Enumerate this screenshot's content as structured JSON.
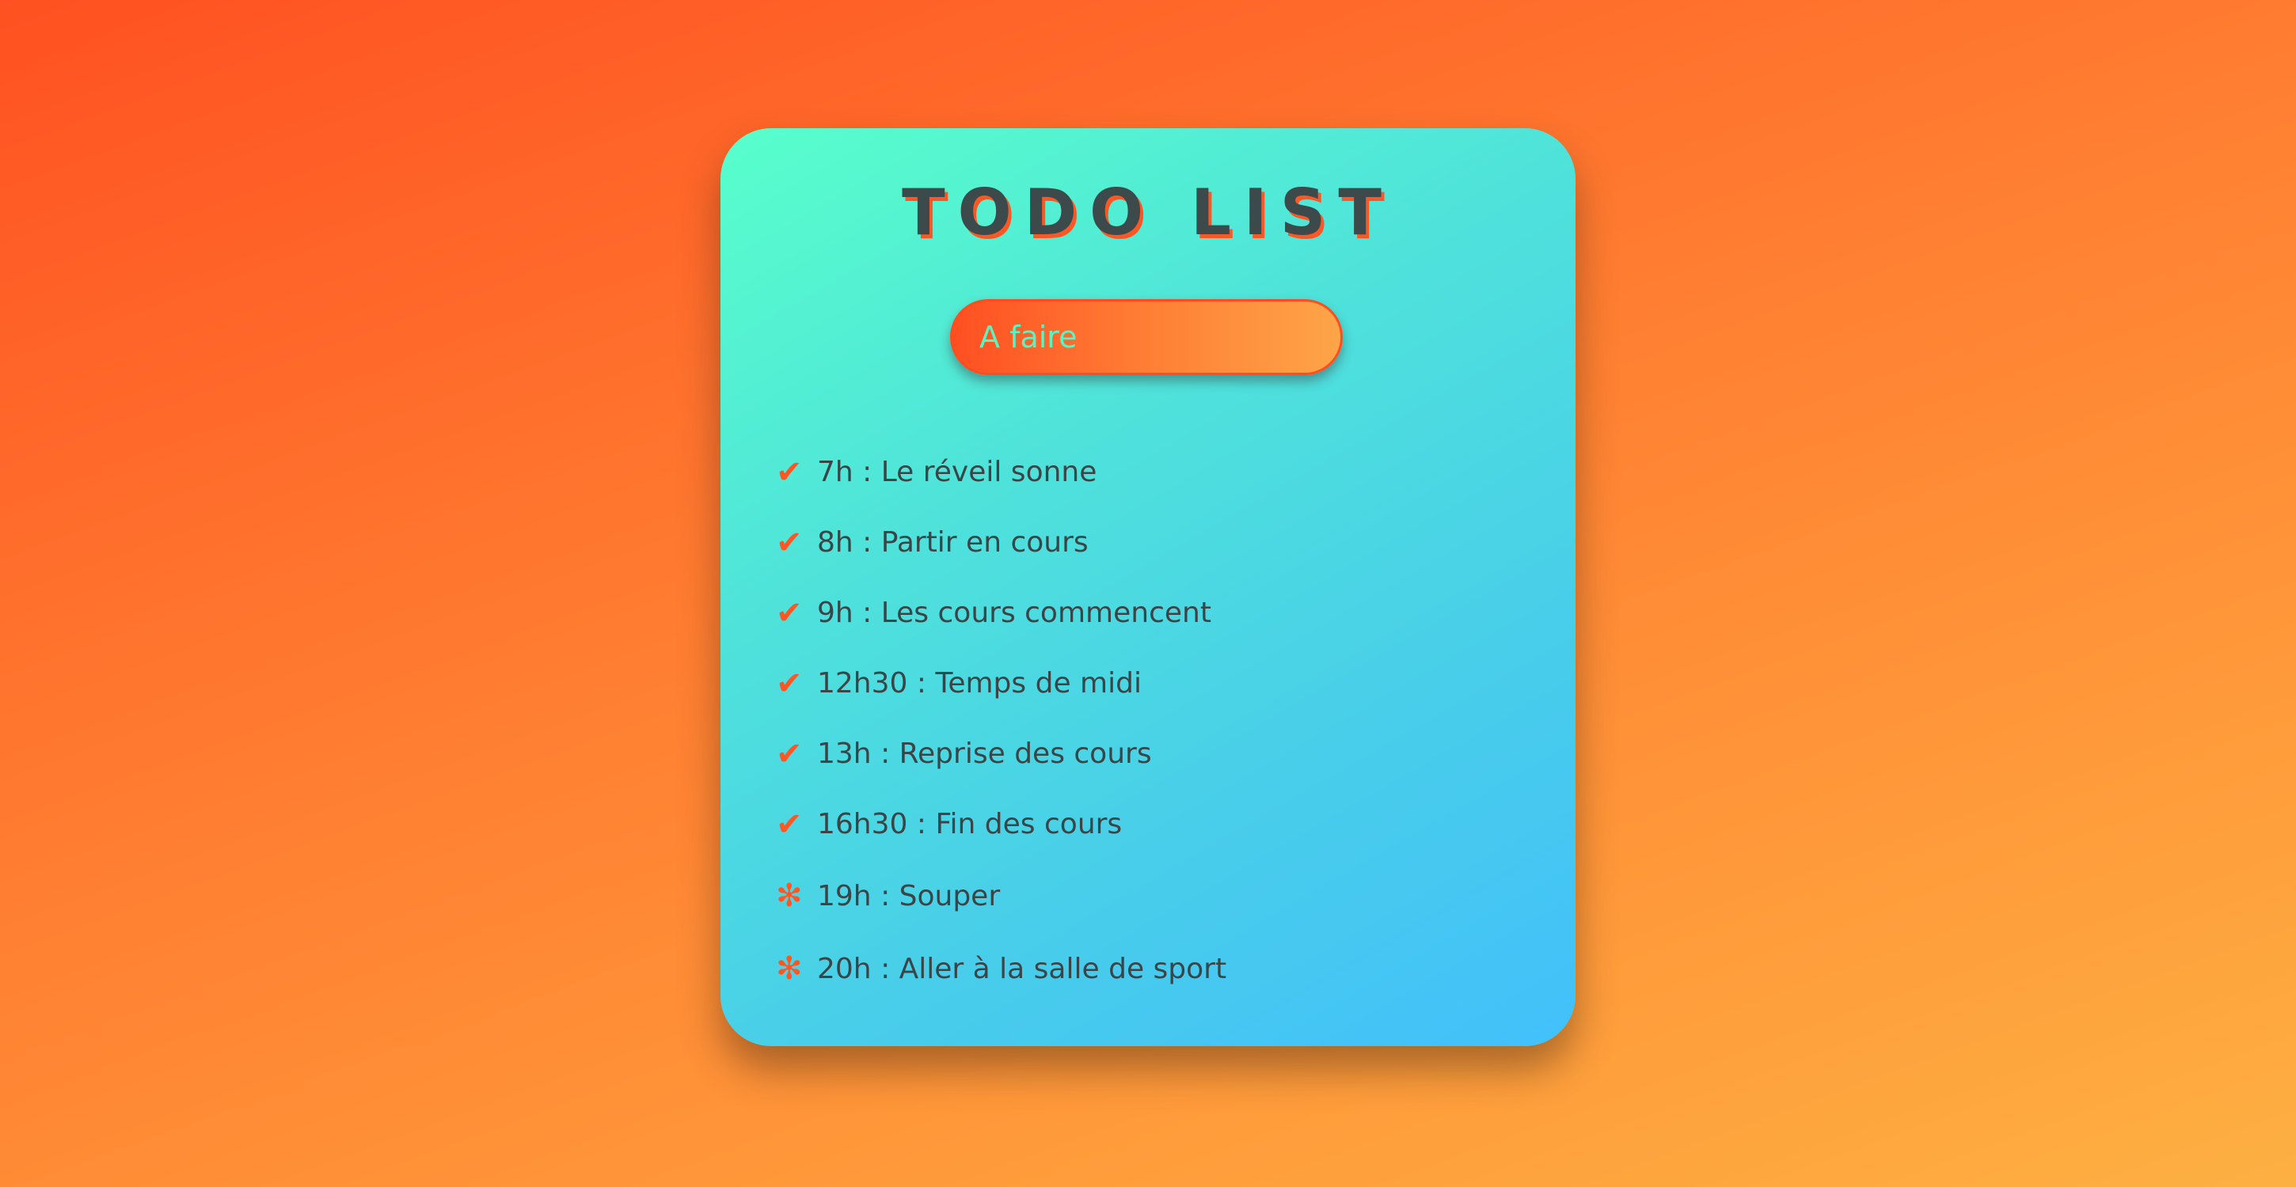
{
  "header": {
    "title": "TODO LIST"
  },
  "input": {
    "placeholder": "A faire"
  },
  "icons": {
    "done": "check-icon",
    "pending": "asterisk-icon"
  },
  "colors": {
    "accent": "#ff5723",
    "text": "#3b4547"
  },
  "tasks": [
    {
      "mark": "✔",
      "text": "7h : Le réveil sonne",
      "status": "done"
    },
    {
      "mark": "✔",
      "text": "8h : Partir en cours",
      "status": "done"
    },
    {
      "mark": "✔",
      "text": "9h : Les cours commencent",
      "status": "done"
    },
    {
      "mark": "✔",
      "text": "12h30 : Temps de midi",
      "status": "done"
    },
    {
      "mark": "✔",
      "text": "13h : Reprise des cours",
      "status": "done"
    },
    {
      "mark": "✔",
      "text": "16h30 : Fin des cours",
      "status": "done"
    },
    {
      "mark": "✻",
      "text": "19h : Souper",
      "status": "pending"
    },
    {
      "mark": "✻",
      "text": "20h : Aller à la salle de sport",
      "status": "pending"
    }
  ]
}
